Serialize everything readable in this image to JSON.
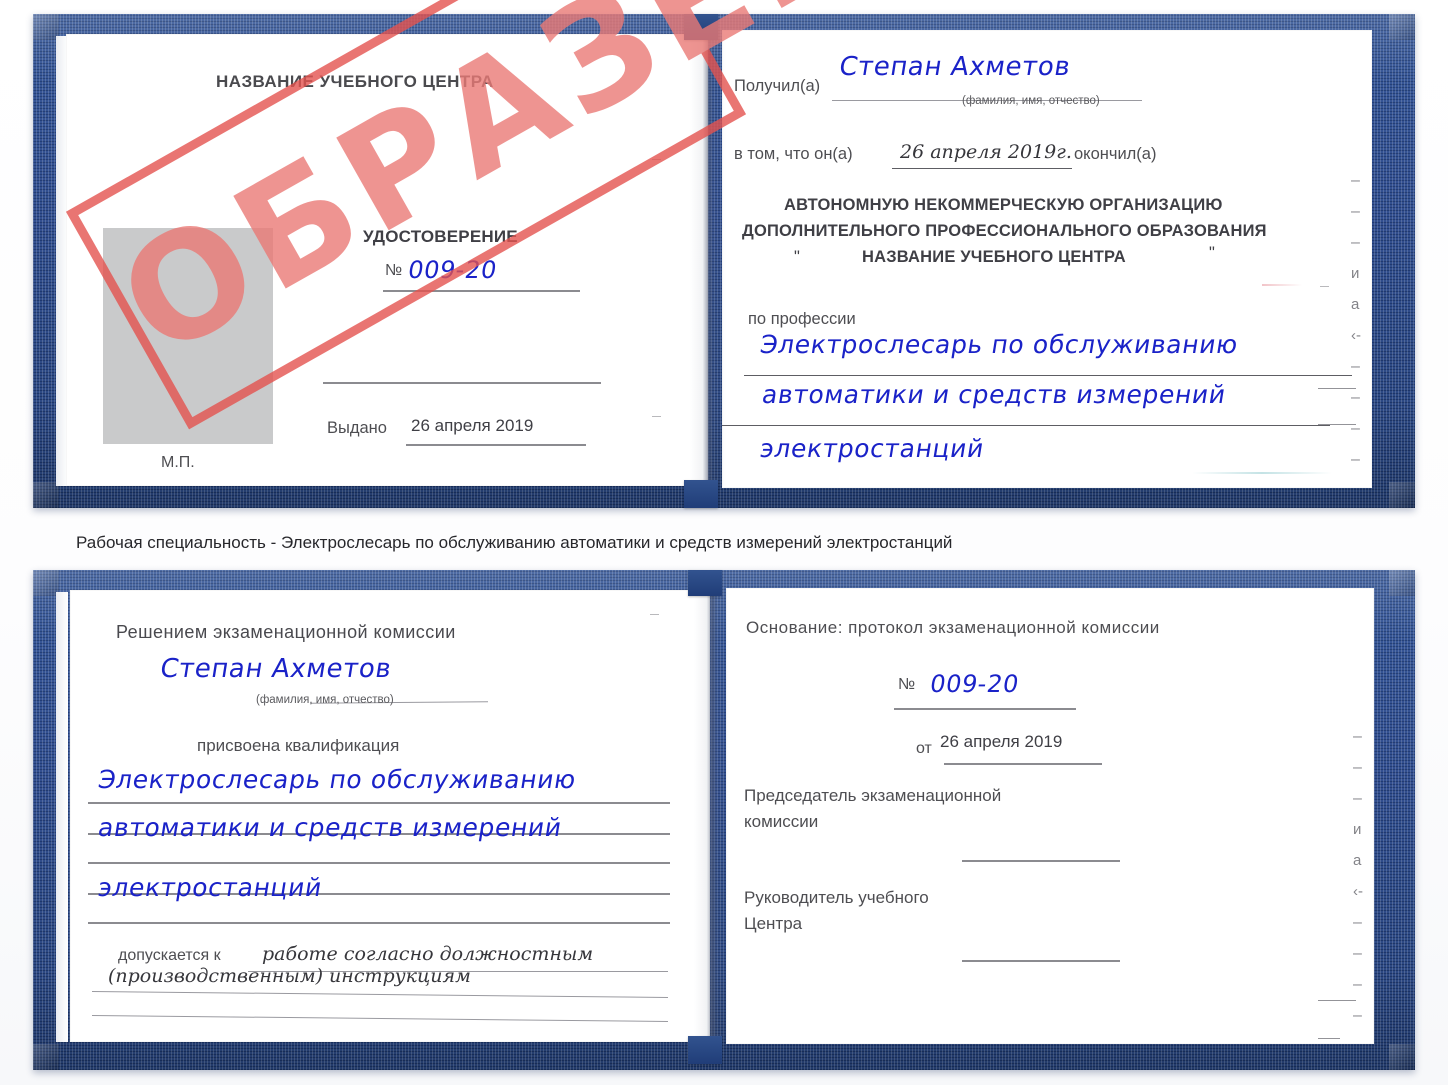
{
  "caption": {
    "text": "Рабочая специальность - Электрослесарь по обслуживанию автоматики и средств измерений электростанций"
  },
  "stamp": {
    "word": "ОБРАЗЕЦ",
    "color": "#e4534f"
  },
  "certificate_top": {
    "left_page": {
      "org_title": "НАЗВАНИЕ УЧЕБНОГО ЦЕНТРА",
      "doc_title": "УДОСТОВЕРЕНИЕ",
      "number_label": "№",
      "number_value": "009-20",
      "issued_label": "Выдано",
      "issued_value": "26 апреля 2019",
      "seal_label": "М.П."
    },
    "right_page": {
      "received_label": "Получил(а)",
      "received_value": "Степан Ахметов",
      "name_hint": "(фамилия, имя, отчество)",
      "that_he_label": "в том, что он(а)",
      "that_he_value": "26 апреля 2019г.",
      "finished_label": "окончил(а)",
      "org_line_1": "АВТОНОМНУЮ НЕКОММЕРЧЕСКУЮ ОРГАНИЗАЦИЮ",
      "org_line_2": "ДОПОЛНИТЕЛЬНОГО ПРОФЕССИОНАЛЬНОГО ОБРАЗОВАНИЯ",
      "org_quote_open": "\"",
      "org_line_3": "НАЗВАНИЕ УЧЕБНОГО ЦЕНТРА",
      "org_quote_close": "\"",
      "profession_label": "по профессии",
      "profession_line_1": "Электрослесарь по обслуживанию",
      "profession_line_2": "автоматики и средств измерений",
      "profession_line_3": "электростанций",
      "margin_bleed": [
        "–",
        "–",
        "–",
        "и",
        "а",
        "‹-",
        "–",
        "–",
        "–",
        "–"
      ]
    }
  },
  "certificate_bottom": {
    "left_page": {
      "decision_title": "Решением экзаменационной комиссии",
      "name_value": "Степан Ахметов",
      "name_hint": "(фамилия, имя, отчество)",
      "qualification_label": "присвоена квалификация",
      "qualification_line_1": "Электрослесарь по обслуживанию",
      "qualification_line_2": "автоматики и средств измерений",
      "qualification_line_3": "электростанций",
      "allowed_label": "допускается к",
      "allowed_value_1": "работе согласно должностным",
      "allowed_value_2": "(производственным) инструкциям"
    },
    "right_page": {
      "basis_label": "Основание: протокол экзаменационной комиссии",
      "number_label": "№",
      "number_value": "009-20",
      "from_label": "от",
      "from_value": "26 апреля 2019",
      "chairman_line_1": "Председатель экзаменационной",
      "chairman_line_2": "комиссии",
      "head_line_1": "Руководитель учебного",
      "head_line_2": "Центра",
      "margin_bleed": [
        "–",
        "–",
        "–",
        "и",
        "а",
        "‹-",
        "–",
        "–",
        "–",
        "–"
      ]
    }
  }
}
